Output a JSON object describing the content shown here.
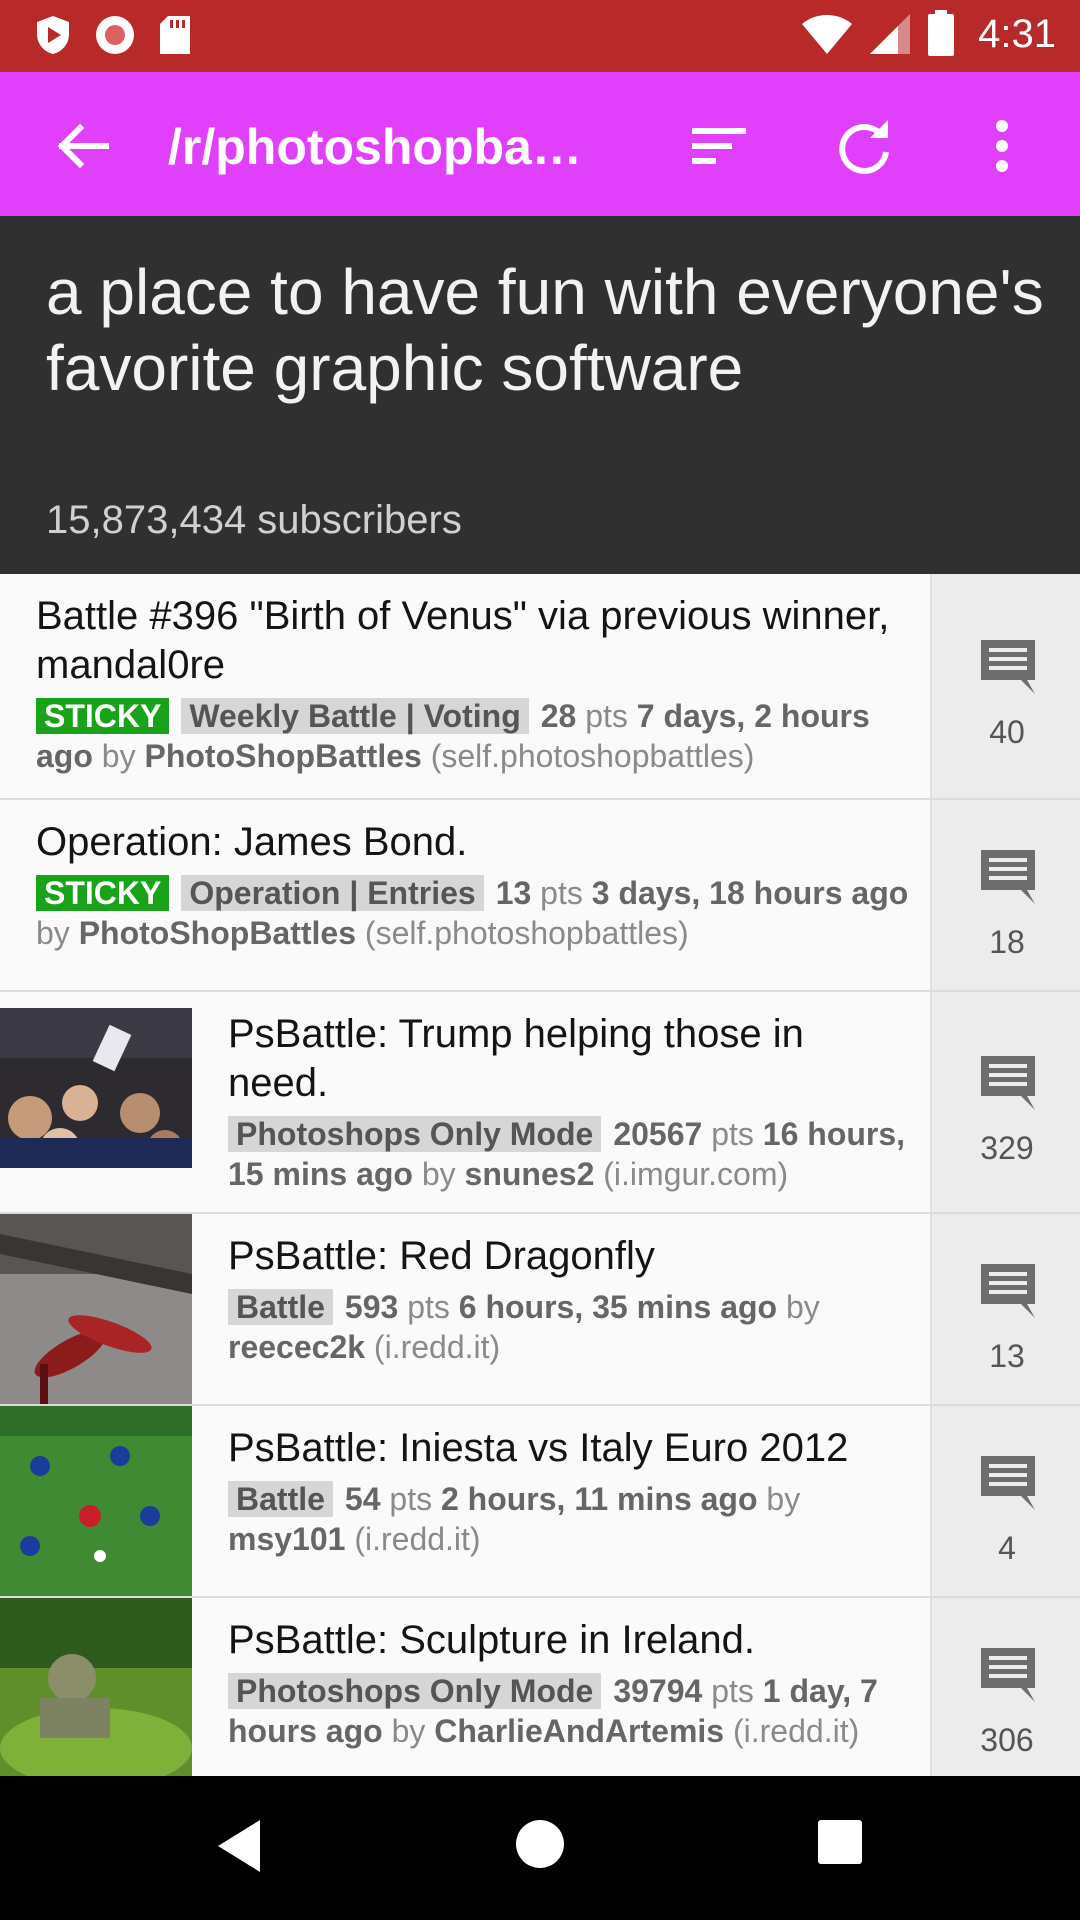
{
  "status": {
    "time": "4:31"
  },
  "appbar": {
    "title": "/r/photoshopba…"
  },
  "header": {
    "description": "a place to have fun with everyone's favorite graphic software",
    "subscribers": "15,873,434 subscribers"
  },
  "posts": [
    {
      "title": "Battle #396 \"Birth of Venus\" via previous winner, mandal0re",
      "sticky": "STICKY",
      "flair": "Weekly Battle | Voting",
      "points": "28",
      "pts_label": "pts",
      "time": "7 days, 2 hours ago",
      "by_label": "by",
      "author": "PhotoShopBattles",
      "domain": "(self.photoshopbattles)",
      "comments": "40"
    },
    {
      "title": "Operation: James Bond.",
      "sticky": "STICKY",
      "flair": "Operation | Entries",
      "points": "13",
      "pts_label": "pts",
      "time": "3 days, 18 hours ago",
      "by_label": "by",
      "author": "PhotoShopBattles",
      "domain": "(self.photoshopbattles)",
      "comments": "18"
    },
    {
      "title": "PsBattle: Trump helping those in need.",
      "flair": "Photoshops Only Mode",
      "points": "20567",
      "pts_label": "pts",
      "time": "16 hours, 15 mins ago",
      "by_label": "by",
      "author": "snunes2",
      "domain": "(i.imgur.com)",
      "comments": "329"
    },
    {
      "title": "PsBattle: Red Dragonfly",
      "flair": "Battle",
      "points": "593",
      "pts_label": "pts",
      "time": "6 hours, 35 mins ago",
      "by_label": "by",
      "author": "reecec2k",
      "domain": "(i.redd.it)",
      "comments": "13"
    },
    {
      "title": "PsBattle: Iniesta vs Italy Euro 2012",
      "flair": "Battle",
      "points": "54",
      "pts_label": "pts",
      "time": "2 hours, 11 mins ago",
      "by_label": "by",
      "author": "msy101",
      "domain": "(i.redd.it)",
      "comments": "4"
    },
    {
      "title": "PsBattle: Sculpture in Ireland.",
      "flair": "Photoshops Only Mode",
      "points": "39794",
      "pts_label": "pts",
      "time": "1 day, 7 hours ago",
      "by_label": "by",
      "author": "CharlieAndArtemis",
      "domain": "(i.redd.it)",
      "comments": "306"
    }
  ],
  "colors": {
    "status_bar": "#b82a2a",
    "app_bar": "#e040fb",
    "header_bg": "#303030",
    "sticky": "#18a31a"
  },
  "icons": {
    "back": "arrow-left-icon",
    "sort": "sort-icon",
    "refresh": "refresh-icon",
    "more": "more-vertical-icon",
    "comments": "comment-icon"
  }
}
